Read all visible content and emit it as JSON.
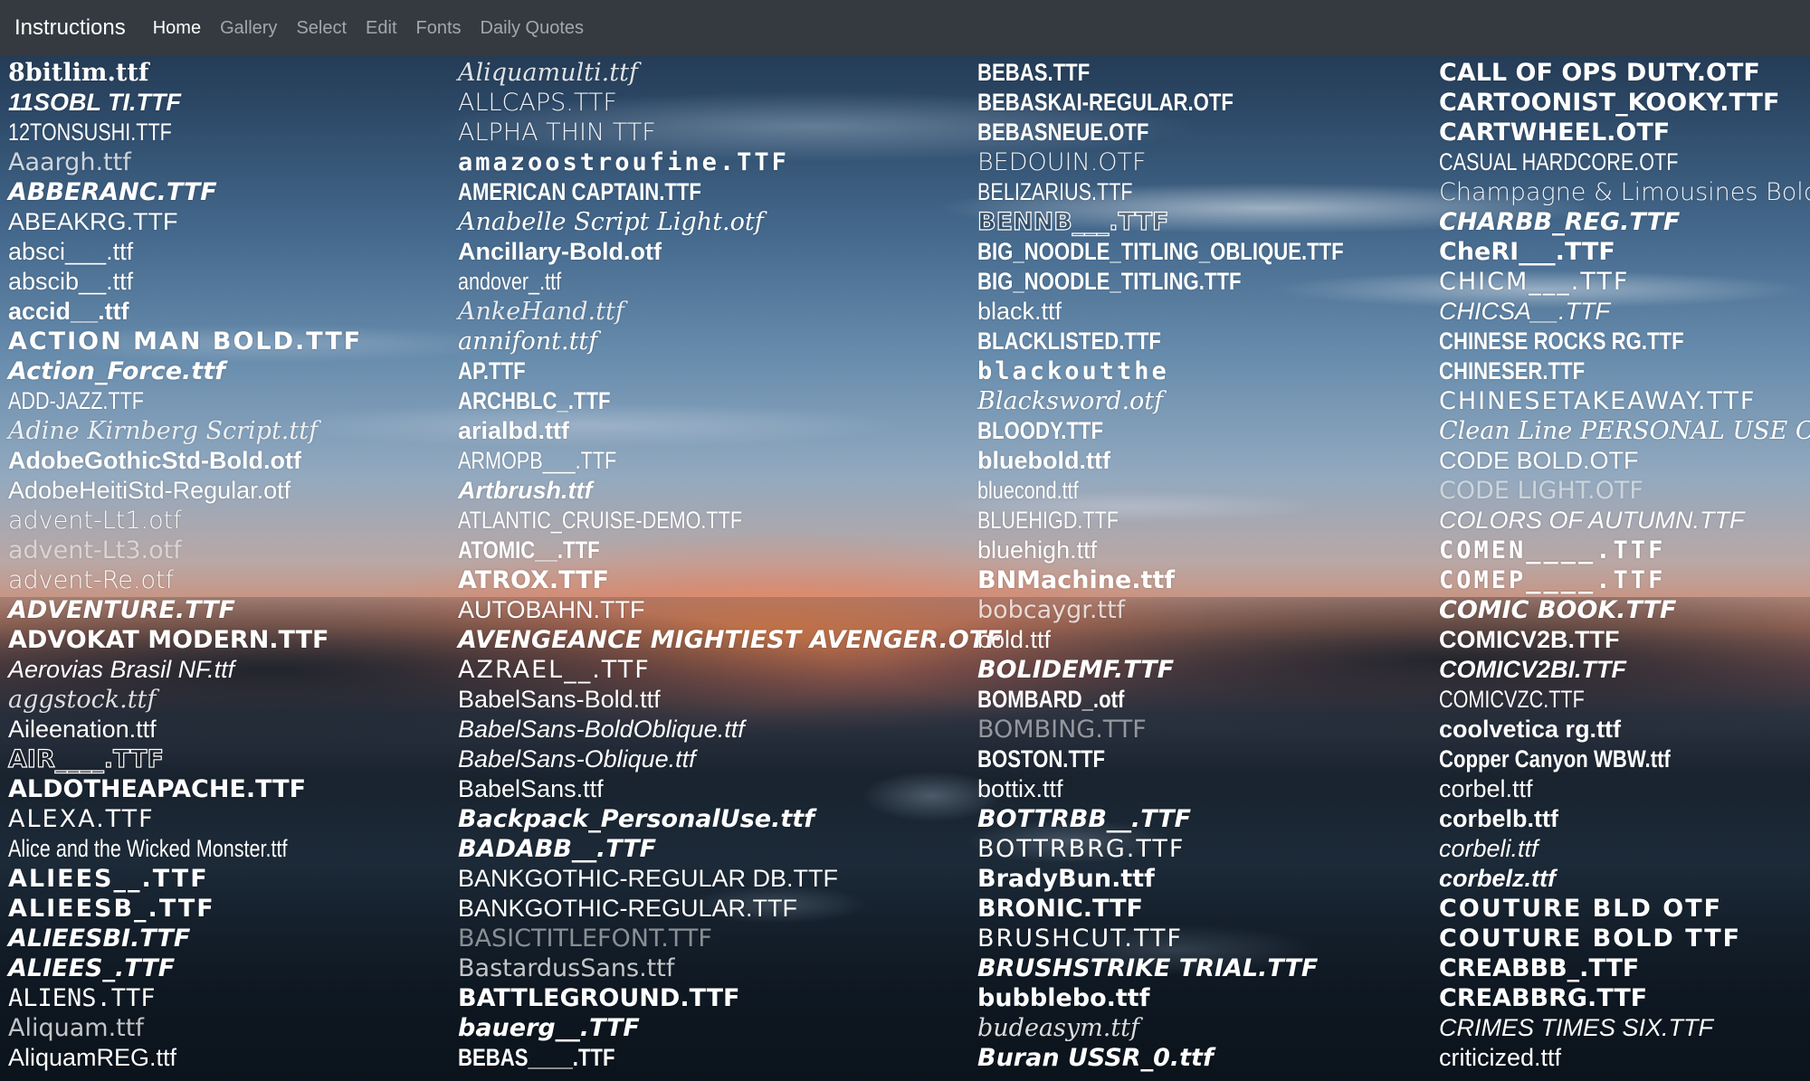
{
  "navbar": {
    "brand": "Instructions",
    "links": [
      {
        "label": "Home",
        "active": true
      },
      {
        "label": "Gallery",
        "active": false
      },
      {
        "label": "Select",
        "active": false
      },
      {
        "label": "Edit",
        "active": false
      },
      {
        "label": "Fonts",
        "active": false
      },
      {
        "label": "Daily Quotes",
        "active": false
      }
    ]
  },
  "fonts": {
    "columns": [
      [
        {
          "name": "8bitlim.ttf",
          "style": "v-serif-b"
        },
        {
          "name": "11SOBL TI.TTF",
          "style": "v-sans-bi"
        },
        {
          "name": "12TONSUSHI.TTF",
          "style": "v-cond-l"
        },
        {
          "name": "Aaargh.ttf",
          "style": "v-light"
        },
        {
          "name": "ABBERANC.TTF",
          "style": "v-heavy-i"
        },
        {
          "name": "ABEAKRG.TTF",
          "style": "v-sans"
        },
        {
          "name": "absci___.ttf",
          "style": "v-sans"
        },
        {
          "name": "abscib__.ttf",
          "style": "v-sans"
        },
        {
          "name": "accid__.ttf",
          "style": "v-sans-b"
        },
        {
          "name": "ACTION MAN BOLD.TTF",
          "style": "v-wide-b"
        },
        {
          "name": "Action_Force.ttf",
          "style": "v-heavy-i"
        },
        {
          "name": "ADD-JAZZ.TTF",
          "style": "v-cond-l"
        },
        {
          "name": "Adine Kirnberg Script.ttf",
          "style": "v-script-l"
        },
        {
          "name": "AdobeGothicStd-Bold.otf",
          "style": "v-sans-b"
        },
        {
          "name": "AdobeHeitiStd-Regular.otf",
          "style": "v-sans"
        },
        {
          "name": "advent-Lt1.otf",
          "style": "v-thin"
        },
        {
          "name": "advent-Lt3.otf",
          "style": "v-faint"
        },
        {
          "name": "advent-Re.otf",
          "style": "v-thin"
        },
        {
          "name": "ADVENTURE.TTF",
          "style": "v-heavy-i"
        },
        {
          "name": "ADVOKAT MODERN.TTF",
          "style": "v-heavy"
        },
        {
          "name": "Aerovias Brasil NF.ttf",
          "style": "v-sans-i"
        },
        {
          "name": "aggstock.ttf",
          "style": "v-script-l"
        },
        {
          "name": "Aileenation.ttf",
          "style": "v-sans"
        },
        {
          "name": "AIR____.TTF",
          "style": "v-outline"
        },
        {
          "name": "ALDOTHEAPACHE.TTF",
          "style": "v-heavy"
        },
        {
          "name": "ALEXA.TTF",
          "style": "v-wide"
        },
        {
          "name": "Alice and the Wicked Monster.ttf",
          "style": "v-cond-l"
        },
        {
          "name": "ALIEES__.TTF",
          "style": "v-wide-b"
        },
        {
          "name": "ALIEESB_.TTF",
          "style": "v-wide-b"
        },
        {
          "name": "ALIEESBI.TTF",
          "style": "v-heavy-i"
        },
        {
          "name": "ALIEES_.TTF",
          "style": "v-heavy-i"
        },
        {
          "name": "ALIENS.TTF",
          "style": "v-mono"
        },
        {
          "name": "Aliquam.ttf",
          "style": "v-light"
        },
        {
          "name": "AliquamREG.ttf",
          "style": "v-sans"
        }
      ],
      [
        {
          "name": "Aliquamulti.ttf",
          "style": "v-script-l"
        },
        {
          "name": "ALLCAPS.TTF",
          "style": "v-thin"
        },
        {
          "name": "ALPHA THIN TTF",
          "style": "v-thin"
        },
        {
          "name": "amazoostroufine.TTF",
          "style": "v-box"
        },
        {
          "name": "AMERICAN CAPTAIN.TTF",
          "style": "v-cond"
        },
        {
          "name": "Anabelle Script Light.otf",
          "style": "v-script"
        },
        {
          "name": "Ancillary-Bold.otf",
          "style": "v-sans-b"
        },
        {
          "name": "andover_.ttf",
          "style": "v-cond-l"
        },
        {
          "name": "AnkeHand.ttf",
          "style": "v-script-l"
        },
        {
          "name": "annifont.ttf",
          "style": "v-script"
        },
        {
          "name": "AP.TTF",
          "style": "v-cond"
        },
        {
          "name": "ARCHBLC_.TTF",
          "style": "v-cond"
        },
        {
          "name": "arialbd.ttf",
          "style": "v-sans-b"
        },
        {
          "name": "ARMOPB___.TTF",
          "style": "v-cond-l"
        },
        {
          "name": "Artbrush.ttf",
          "style": "v-sans-bi"
        },
        {
          "name": "ATLANTIC_CRUISE-DEMO.TTF",
          "style": "v-cond-l"
        },
        {
          "name": "ATOMIC__.TTF",
          "style": "v-cond"
        },
        {
          "name": "ATROX.TTF",
          "style": "v-heavy"
        },
        {
          "name": "AUTOBAHN.TTF",
          "style": "v-sans"
        },
        {
          "name": "AVENGEANCE MIGHTIEST AVENGER.OTF",
          "style": "v-heavy-i"
        },
        {
          "name": "AZRAEL__.TTF",
          "style": "v-wide"
        },
        {
          "name": "BabelSans-Bold.ttf",
          "style": "v-sans"
        },
        {
          "name": "BabelSans-BoldOblique.ttf",
          "style": "v-sans-i"
        },
        {
          "name": "BabelSans-Oblique.ttf",
          "style": "v-sans-i"
        },
        {
          "name": "BabelSans.ttf",
          "style": "v-sans"
        },
        {
          "name": "Backpack_PersonalUse.ttf",
          "style": "v-heavy-i"
        },
        {
          "name": "BADABB__.TTF",
          "style": "v-heavy-i"
        },
        {
          "name": "BANKGOTHIC-REGULAR DB.TTF",
          "style": "v-sans"
        },
        {
          "name": "BANKGOTHIC-REGULAR.TTF",
          "style": "v-sans"
        },
        {
          "name": "BASICTITLEFONT.TTF",
          "style": "v-faint"
        },
        {
          "name": "BastardusSans.ttf",
          "style": "v-light"
        },
        {
          "name": "BATTLEGROUND.TTF",
          "style": "v-heavy"
        },
        {
          "name": "bauerg__.TTF",
          "style": "v-heavy-i"
        },
        {
          "name": "BEBAS____.TTF",
          "style": "v-cond"
        }
      ],
      [
        {
          "name": "BEBAS.TTF",
          "style": "v-cond"
        },
        {
          "name": "BEBASKAI-REGULAR.OTF",
          "style": "v-cond"
        },
        {
          "name": "BEBASNEUE.OTF",
          "style": "v-cond"
        },
        {
          "name": "BEDOUIN.OTF",
          "style": "v-thin"
        },
        {
          "name": "BELIZARIUS.TTF",
          "style": "v-cond-l"
        },
        {
          "name": "BENNB___.TTF",
          "style": "v-outline"
        },
        {
          "name": "BIG_NOODLE_TITLING_OBLIQUE.TTF",
          "style": "v-cond"
        },
        {
          "name": "BIG_NOODLE_TITLING.TTF",
          "style": "v-cond"
        },
        {
          "name": "black.ttf",
          "style": "v-sans"
        },
        {
          "name": "BLACKLISTED.TTF",
          "style": "v-cond"
        },
        {
          "name": "blackoutthe",
          "style": "v-box"
        },
        {
          "name": "Blacksword.otf",
          "style": "v-script"
        },
        {
          "name": "BLOODY.TTF",
          "style": "v-cond"
        },
        {
          "name": "bluebold.ttf",
          "style": "v-sans-b"
        },
        {
          "name": "bluecond.ttf",
          "style": "v-cond-l"
        },
        {
          "name": "BLUEHIGD.TTF",
          "style": "v-cond-l"
        },
        {
          "name": "bluehigh.ttf",
          "style": "v-sans"
        },
        {
          "name": "BNMachine.ttf",
          "style": "v-heavy"
        },
        {
          "name": "bobcaygr.ttf",
          "style": "v-light"
        },
        {
          "name": "bold.ttf",
          "style": "v-sans"
        },
        {
          "name": "BOLIDEMF.TTF",
          "style": "v-heavy-i"
        },
        {
          "name": "BOMBARD_.otf",
          "style": "v-cond"
        },
        {
          "name": "BOMBING.TTF",
          "style": "v-faint"
        },
        {
          "name": "BOSTON.TTF",
          "style": "v-cond"
        },
        {
          "name": "bottix.ttf",
          "style": "v-sans"
        },
        {
          "name": "BOTTRBB__.TTF",
          "style": "v-heavy-i"
        },
        {
          "name": "BOTTRBRG.TTF",
          "style": "v-wide"
        },
        {
          "name": "BradyBun.ttf",
          "style": "v-heavy"
        },
        {
          "name": "BRONIC.TTF",
          "style": "v-heavy"
        },
        {
          "name": "BRUSHCUT.TTF",
          "style": "v-wide"
        },
        {
          "name": "BRUSHSTRIKE TRIAL.TTF",
          "style": "v-heavy-i"
        },
        {
          "name": "bubblebo.ttf",
          "style": "v-heavy"
        },
        {
          "name": "budeasym.ttf",
          "style": "v-script-l"
        },
        {
          "name": "Buran USSR_0.ttf",
          "style": "v-heavy-i"
        }
      ],
      [
        {
          "name": "CALL OF OPS DUTY.OTF",
          "style": "v-heavy"
        },
        {
          "name": "CARTOONIST_KOOKY.TTF",
          "style": "v-heavy"
        },
        {
          "name": "CARTWHEEL.OTF",
          "style": "v-heavy"
        },
        {
          "name": "CASUAL HARDCORE.OTF",
          "style": "v-cond-l"
        },
        {
          "name": "Champagne & Limousines Bold.ttf",
          "style": "v-thin"
        },
        {
          "name": "CHARBB_REG.TTF",
          "style": "v-heavy-i"
        },
        {
          "name": "CheRI___.TTF",
          "style": "v-heavy"
        },
        {
          "name": "CHICM___.TTF",
          "style": "v-wide"
        },
        {
          "name": "CHICSA__.TTF",
          "style": "v-sans-i"
        },
        {
          "name": "CHINESE ROCKS RG.TTF",
          "style": "v-cond"
        },
        {
          "name": "CHINESER.TTF",
          "style": "v-cond"
        },
        {
          "name": "CHINESETAKEAWAY.TTF",
          "style": "v-wide"
        },
        {
          "name": "Clean Line PERSONAL USE ONLY.ttf",
          "style": "v-script"
        },
        {
          "name": "CODE BOLD.OTF",
          "style": "v-sans"
        },
        {
          "name": "CODE LIGHT.OTF",
          "style": "v-faint"
        },
        {
          "name": "COLORS OF AUTUMN.TTF",
          "style": "v-sans-i"
        },
        {
          "name": "COMEN____.TTF",
          "style": "v-box"
        },
        {
          "name": "COMEP____.TTF",
          "style": "v-box"
        },
        {
          "name": "COMIC BOOK.TTF",
          "style": "v-heavy-i"
        },
        {
          "name": "COMICV2B.TTF",
          "style": "v-sans-b"
        },
        {
          "name": "COMICV2BI.TTF",
          "style": "v-sans-bi"
        },
        {
          "name": "COMICVZC.TTF",
          "style": "v-cond-l"
        },
        {
          "name": "coolvetica rg.ttf",
          "style": "v-sans-b"
        },
        {
          "name": "Copper Canyon WBW.ttf",
          "style": "v-cond"
        },
        {
          "name": "corbel.ttf",
          "style": "v-sans"
        },
        {
          "name": "corbelb.ttf",
          "style": "v-sans-b"
        },
        {
          "name": "corbeli.ttf",
          "style": "v-sans-i"
        },
        {
          "name": "corbelz.ttf",
          "style": "v-sans-bi"
        },
        {
          "name": "COUTURE BLD OTF",
          "style": "v-wide-b"
        },
        {
          "name": "COUTURE BOLD TTF",
          "style": "v-wide-b"
        },
        {
          "name": "CREABBB_.TTF",
          "style": "v-heavy"
        },
        {
          "name": "CREABBRG.TTF",
          "style": "v-heavy"
        },
        {
          "name": "CRIMES TIMES SIX.TTF",
          "style": "v-sans-i"
        },
        {
          "name": "criticized.ttf",
          "style": "v-sans"
        }
      ]
    ]
  }
}
